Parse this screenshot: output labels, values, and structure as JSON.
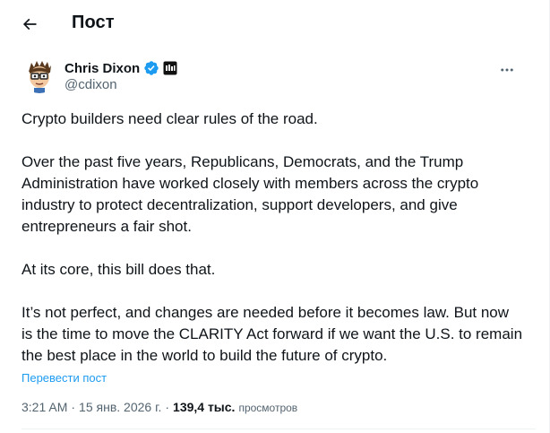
{
  "header": {
    "title": "Пост",
    "back_icon": "arrow-left-icon"
  },
  "author": {
    "display_name": "Chris Dixon",
    "handle": "@cdixon",
    "verified_color": "#1d9bf0",
    "more_icon": "more-horizontal-icon"
  },
  "tweet": {
    "paragraphs": [
      "Crypto builders need clear rules of the road.",
      "Over the past five years, Republicans, Democrats, and the Trump Administration have worked closely with members across the crypto industry to protect decentralization, support developers, and give entrepreneurs a fair shot.",
      "At its core, this bill does that.",
      "It’s not perfect, and changes are needed before it becomes law. But now is the time to move the CLARITY Act forward if we want the U.S. to remain the best place in the world to build the future of crypto."
    ],
    "translate_label": "Перевести пост"
  },
  "meta": {
    "time": "3:21 AM",
    "separator": "·",
    "date": "15 янв. 2026 г.",
    "views_count": "139,4 тыс.",
    "views_label": "просмотров"
  },
  "colors": {
    "text": "#0f1419",
    "secondary": "#536471",
    "accent": "#1d9bf0"
  }
}
